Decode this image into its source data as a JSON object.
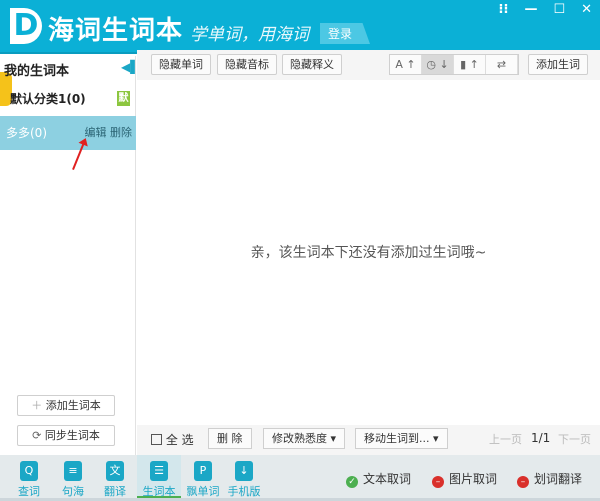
{
  "header": {
    "logo": "D",
    "title": "海词生词本",
    "slogan": "学单词，用海词",
    "login": "登录",
    "win": [
      "grid-icon",
      "minimize-icon",
      "maximize-icon",
      "close-icon"
    ]
  },
  "sidebar": {
    "title": "我的生词本",
    "items": [
      {
        "label": "默认分类1(0)",
        "badge": "默"
      },
      {
        "label": "多多(0)",
        "edit": "编辑",
        "delete": "删除"
      }
    ],
    "add": "添加生词本",
    "sync": "同步生词本"
  },
  "toolbar": {
    "hide_word": "隐藏单词",
    "hide_phonetic": "隐藏音标",
    "hide_meaning": "隐藏释义",
    "sort": [
      "A ↑",
      "◷ ↓",
      "▮ ↑",
      "⇄"
    ],
    "add_word": "添加生词"
  },
  "main": {
    "empty": "亲，该生词本下还没有添加过生词哦~"
  },
  "bottom": {
    "select_all": "全 选",
    "delete": "删 除",
    "familiarity": "修改熟悉度 ▾",
    "move": "移动生词到... ▾",
    "prev": "上一页",
    "page": "1/1",
    "next": "下一页"
  },
  "footer": {
    "nav": [
      {
        "label": "查词",
        "icon": "Q"
      },
      {
        "label": "句海",
        "icon": "≡"
      },
      {
        "label": "翻译",
        "icon": "文"
      },
      {
        "label": "生词本",
        "icon": "☰"
      },
      {
        "label": "飘单词",
        "icon": "P"
      },
      {
        "label": "手机版",
        "icon": "↓"
      }
    ],
    "toggles": [
      {
        "label": "文本取词",
        "state": "on"
      },
      {
        "label": "图片取词",
        "state": "off"
      },
      {
        "label": "划词翻译",
        "state": "off"
      }
    ]
  },
  "colors": {
    "brand": "#0bb0d6",
    "on": "#4caf50",
    "off": "#d9302b"
  }
}
